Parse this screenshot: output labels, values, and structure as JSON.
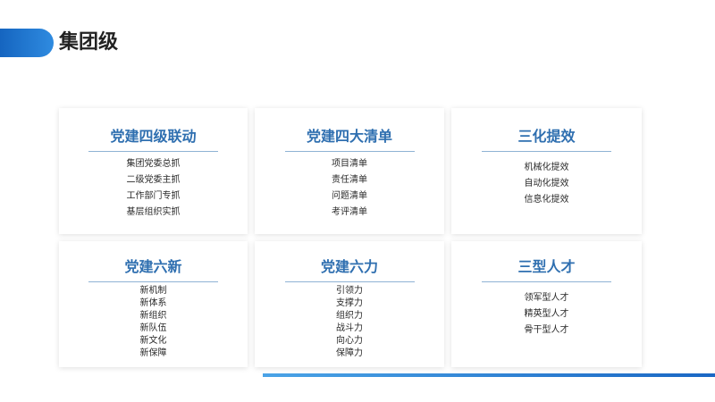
{
  "header": {
    "title": "集团级"
  },
  "cards": [
    {
      "title": "党建四级联动",
      "items": [
        "集团党委总抓",
        "二级党委主抓",
        "工作部门专抓",
        "基层组织实抓"
      ]
    },
    {
      "title": "党建四大清单",
      "items": [
        "项目清单",
        "责任清单",
        "问题清单",
        "考评清单"
      ]
    },
    {
      "title": "三化提效",
      "items": [
        "机械化提效",
        "自动化提效",
        "信息化提效"
      ]
    },
    {
      "title": "党建六新",
      "items": [
        "新机制",
        "新体系",
        "新组织",
        "新队伍",
        "新文化",
        "新保障"
      ]
    },
    {
      "title": "党建六力",
      "items": [
        "引领力",
        "支撑力",
        "组织力",
        "战斗力",
        "向心力",
        "保障力"
      ]
    },
    {
      "title": "三型人才",
      "items": [
        "领军型人才",
        "精英型人才",
        "骨干型人才"
      ]
    }
  ],
  "colors": {
    "accent_blue": "#1565c0",
    "card_title": "#2f6fb0",
    "divider": "#8fb3d4"
  }
}
